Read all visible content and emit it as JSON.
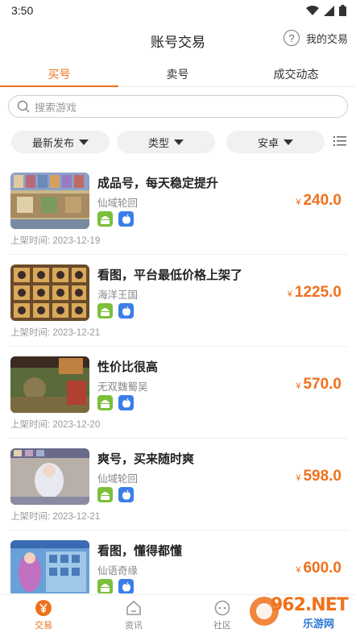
{
  "status": {
    "time": "3:50"
  },
  "header": {
    "title": "账号交易",
    "my_deal": "我的交易"
  },
  "tabs": [
    {
      "label": "买号",
      "active": true
    },
    {
      "label": "卖号",
      "active": false
    },
    {
      "label": "成交动态",
      "active": false
    }
  ],
  "search": {
    "placeholder": "搜索游戏"
  },
  "filters": [
    {
      "label": "最新发布"
    },
    {
      "label": "类型"
    },
    {
      "label": "安卓"
    }
  ],
  "listings": [
    {
      "title": "成品号，每天稳定提升",
      "game": "仙域轮回",
      "price": "240.0",
      "currency": "¥",
      "date": "上架时间: 2023-12-19",
      "platforms": [
        "android",
        "ios"
      ]
    },
    {
      "title": "看图，平台最低价格上架了",
      "game": "海洋王国",
      "price": "1225.0",
      "currency": "¥",
      "date": "上架时间: 2023-12-21",
      "platforms": [
        "android",
        "ios"
      ]
    },
    {
      "title": "性价比很高",
      "game": "无双魏蜀吴",
      "price": "570.0",
      "currency": "¥",
      "date": "上架时间: 2023-12-20",
      "platforms": [
        "android",
        "ios"
      ]
    },
    {
      "title": "爽号，买来随时爽",
      "game": "仙域轮回",
      "price": "598.0",
      "currency": "¥",
      "date": "上架时间: 2023-12-21",
      "platforms": [
        "android",
        "ios"
      ]
    },
    {
      "title": "看图，懂得都懂",
      "game": "仙语奇缘",
      "price": "600.0",
      "currency": "¥",
      "date": "",
      "platforms": [
        "android",
        "ios"
      ]
    }
  ],
  "bottom_nav": [
    {
      "label": "交易",
      "icon": "yen-circle-icon",
      "active": true
    },
    {
      "label": "资讯",
      "icon": "home-icon",
      "active": false
    },
    {
      "label": "社区",
      "icon": "chat-icon",
      "active": false
    }
  ],
  "watermark": {
    "brand": "962.NET",
    "sub": "乐游网"
  },
  "colors": {
    "accent": "#f0711c",
    "android": "#7bbf3a",
    "ios": "#3b7ee8"
  }
}
